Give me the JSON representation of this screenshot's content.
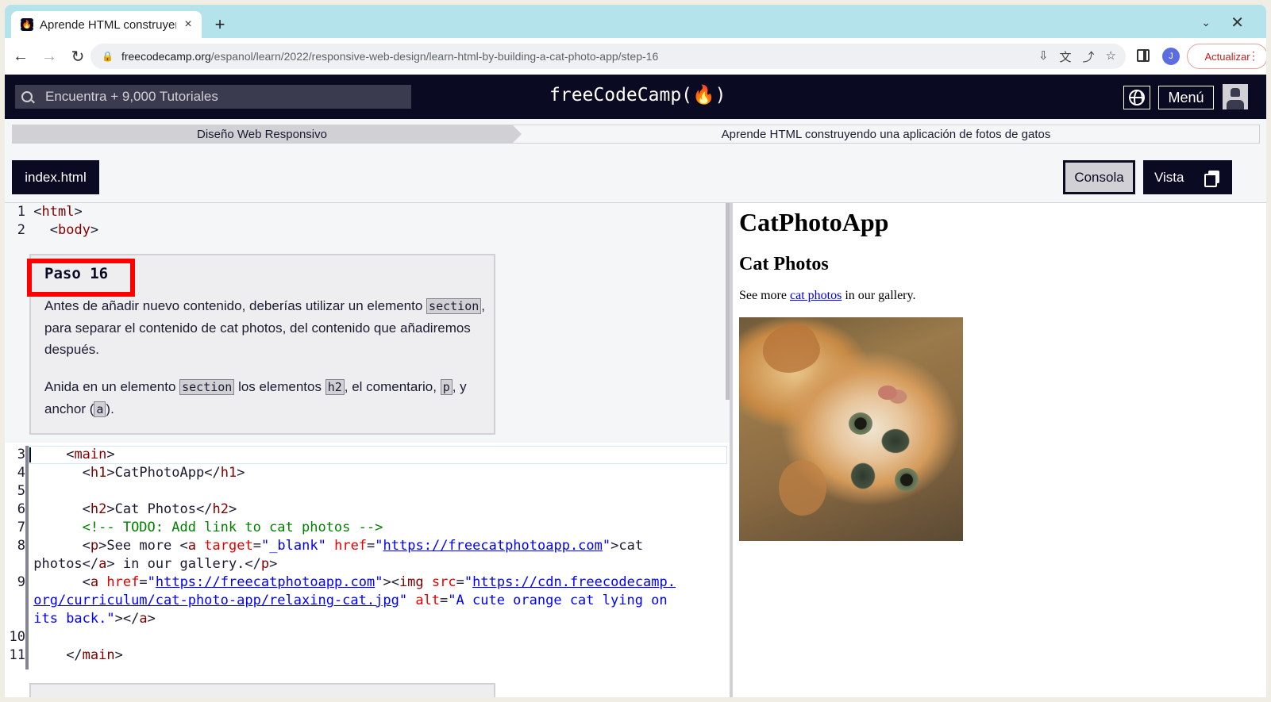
{
  "browser": {
    "tab_title": "Aprende HTML construyendo una",
    "tab_close": "×",
    "new_tab": "+",
    "tab_menu": "⌄",
    "window_close": "✕",
    "url_domain": "freecodecamp.org",
    "url_path": "/espanol/learn/2022/responsive-web-design/learn-html-by-building-a-cat-photo-app/step-16",
    "profile_initial": "J",
    "update_label": "Actualizar",
    "update_more": "⋮"
  },
  "fcc": {
    "search_placeholder": "Encuentra + 9,000 Tutoriales",
    "logo": "freeCodeCamp(🔥)",
    "menu_label": "Menú",
    "breadcrumb_1": "Diseño Web Responsivo",
    "breadcrumb_2": "Aprende HTML construyendo una aplicación de fotos de gatos",
    "file_tab": "index.html",
    "console_label": "Consola",
    "preview_label": "Vista"
  },
  "step": {
    "title": "Paso 16",
    "p1_a": "Antes de añadir nuevo contenido, deberías utilizar un elemento ",
    "p1_code": "section",
    "p1_b": ", para separar el contenido de cat photos, del contenido que añadiremos después.",
    "p2_a": "Anida en un elemento ",
    "p2_code1": "section",
    "p2_b": " los elementos ",
    "p2_code2": "h2",
    "p2_c": ", el comentario, ",
    "p2_code3": "p",
    "p2_d": ", y anchor (",
    "p2_code4": "a",
    "p2_e": ")."
  },
  "code_lines": {
    "l1": "1",
    "l2": "2",
    "l3": "3",
    "l4": "4",
    "l5": "5",
    "l6": "6",
    "l7": "7",
    "l8": "8",
    "l9": "9",
    "l10": "10",
    "l11": "11",
    "html_tag": "html",
    "body_tag": "body",
    "main_tag": "main",
    "h1_text": "CatPhotoApp",
    "h2_text": "Cat Photos",
    "comment": "<!-- TODO: Add link to cat photos -->",
    "p_text": "See more ",
    "a_target_val": "\"_blank\"",
    "a_href_url": "https://freecatphotoapp.com",
    "a_text_1": "cat",
    "a_text_2": "photos",
    "gallery_text": " in our gallery.",
    "img_href_url": "https://freecatphotoapp.com",
    "img_src_url_1": "https://cdn.freecodecamp.",
    "img_src_url_2": "org/curriculum/cat-photo-app/relaxing-cat.jpg",
    "img_alt_1": "\"A cute orange cat lying on",
    "img_alt_2": "its back.\""
  },
  "preview": {
    "h1": "CatPhotoApp",
    "h2": "Cat Photos",
    "p_before": "See more ",
    "p_link": "cat photos",
    "p_after": " in our gallery."
  }
}
